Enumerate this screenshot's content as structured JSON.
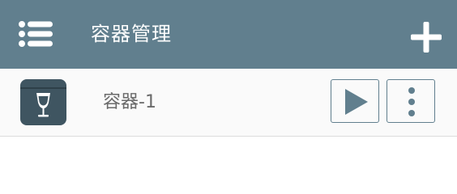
{
  "header": {
    "title": "容器管理",
    "menu_icon": "menu-icon",
    "add_icon": "plus-icon",
    "background_color": "#617f8e"
  },
  "containers": [
    {
      "name": "容器-1",
      "icon": "wine-glass-box-icon",
      "actions": [
        "play-icon",
        "more-vertical-icon"
      ]
    }
  ],
  "colors": {
    "accent": "#617f8e",
    "thumb": "#3f5561",
    "label": "#6a6a6a"
  }
}
